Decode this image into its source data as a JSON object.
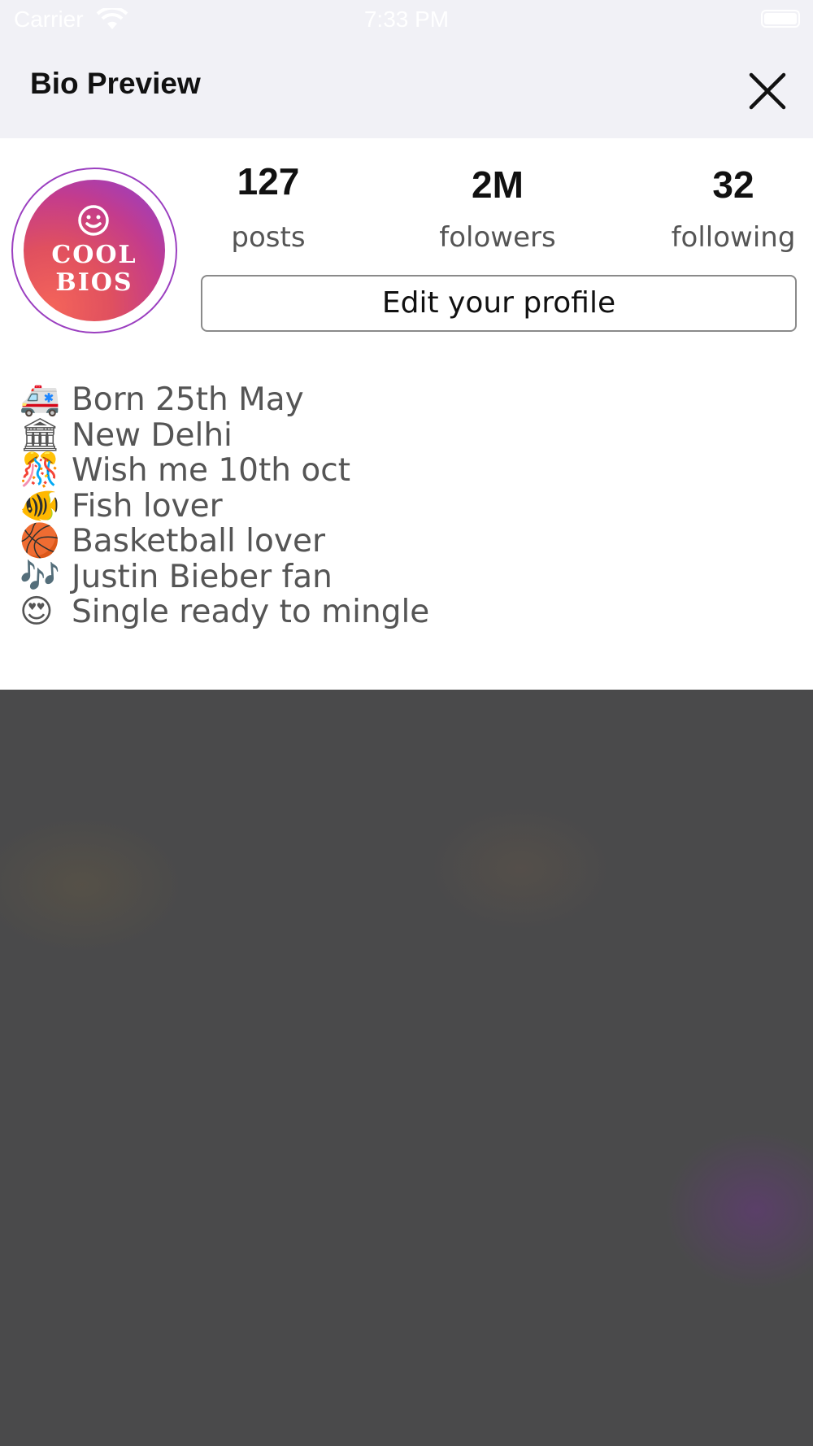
{
  "status_bar": {
    "carrier": "Carrier",
    "time": "7:33 PM",
    "wifi_icon": "wifi-icon",
    "battery_icon": "battery-icon"
  },
  "nav": {
    "title": "Bio Preview",
    "close_icon": "close-icon"
  },
  "profile": {
    "avatar_text_line1": "COOL",
    "avatar_text_line2": "BIOS",
    "stats": [
      {
        "value": "127",
        "label": "posts"
      },
      {
        "value": "2M",
        "label": "folowers"
      },
      {
        "value": "32",
        "label": "following"
      }
    ],
    "edit_button": "Edit your profile"
  },
  "bio": [
    {
      "emoji": "🚑",
      "text": "Born 25th May"
    },
    {
      "emoji": "🏛",
      "text": "New Delhi"
    },
    {
      "emoji": "🎊",
      "text": "Wish me 10th oct"
    },
    {
      "emoji": "🐠",
      "text": "Fish lover"
    },
    {
      "emoji": "🏀",
      "text": "Basketball lover"
    },
    {
      "emoji": "🎶",
      "text": "Justin Bieber fan"
    },
    {
      "emoji": "😍",
      "text": "Single ready to mingle"
    }
  ],
  "colors": {
    "nav_bg": "#f1f1f6",
    "backdrop": "#4a4a4b",
    "avatar_ring": "#9b3fc0"
  }
}
